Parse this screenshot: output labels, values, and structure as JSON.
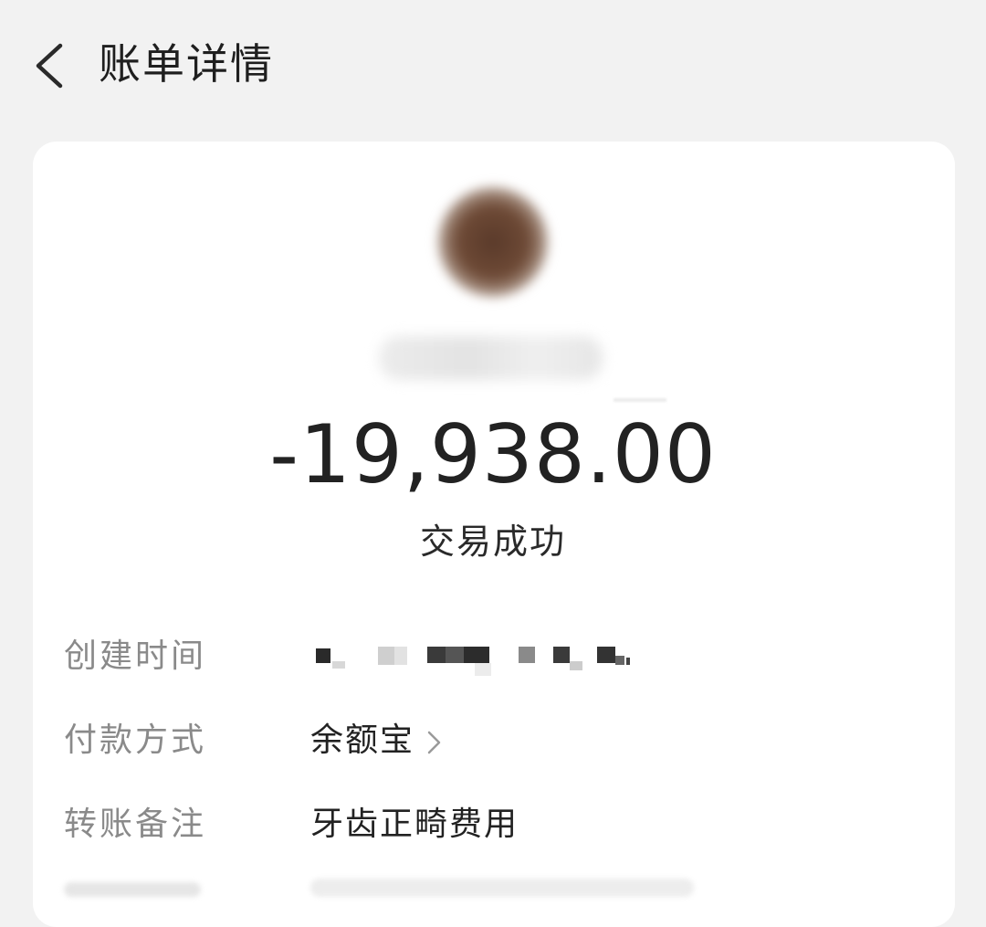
{
  "header": {
    "title": "账单详情",
    "back_icon": "chevron-left-icon"
  },
  "transaction": {
    "amount": "-19,938.00",
    "status": "交易成功"
  },
  "details": {
    "created_time": {
      "label": "创建时间",
      "value": ""
    },
    "payment_method": {
      "label": "付款方式",
      "value": "余额宝",
      "chevron_icon": "chevron-right-icon"
    },
    "transfer_note": {
      "label": "转账备注",
      "value": "牙齿正畸费用"
    }
  },
  "colors": {
    "background": "#f2f2f2",
    "card": "#ffffff",
    "label": "#8a8a8a",
    "text": "#222222"
  }
}
